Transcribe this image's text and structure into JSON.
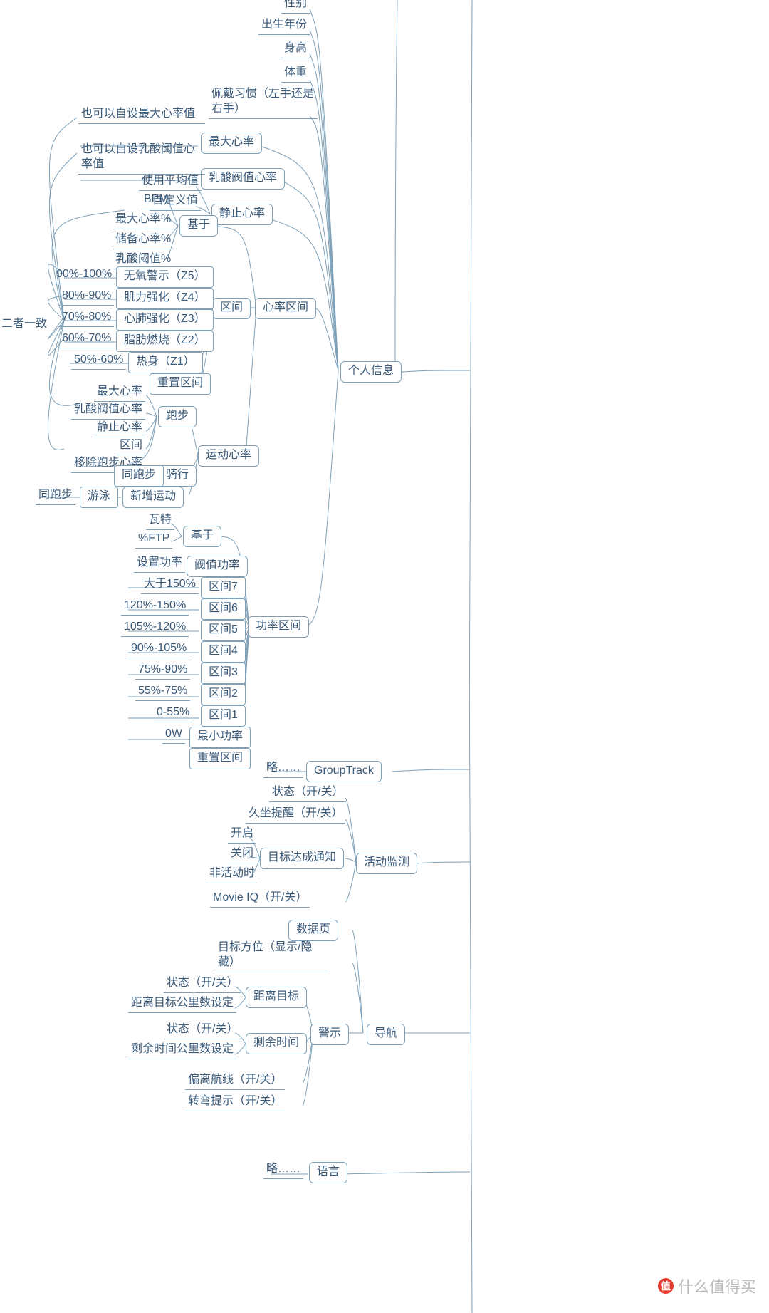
{
  "root_side_label": "二者一致",
  "personal_info": {
    "label": "个人信息",
    "gender": "性别",
    "birth_year": "出生年份",
    "height": "身高",
    "weight": "体重",
    "wear_habit": "佩戴习惯（左手还是右手）",
    "max_hr": {
      "label": "最大心率",
      "note": "也可以自设最大心率值"
    },
    "lactate_hr": {
      "label": "乳酸阀值心率",
      "note": "也可以自设乳酸阈值心率值"
    },
    "resting_hr": {
      "label": "静止心率",
      "avg": "使用平均值",
      "custom": "自定义值"
    },
    "hr_zone": {
      "label": "心率区间",
      "based_on": {
        "label": "基于",
        "opts": [
          "BPM",
          "最大心率%",
          "储备心率%",
          "乳酸阈值%"
        ]
      },
      "zones": {
        "label": "区间",
        "z5": {
          "name": "无氧警示（Z5）",
          "pct": "90%-100%"
        },
        "z4": {
          "name": "肌力强化（Z4）",
          "pct": "80%-90%"
        },
        "z3": {
          "name": "心肺强化（Z3）",
          "pct": "70%-80%"
        },
        "z2": {
          "name": "脂肪燃烧（Z2）",
          "pct": "60%-70%"
        },
        "z1": {
          "name": "热身（Z1）",
          "pct": "50%-60%"
        },
        "reset": "重置区间"
      },
      "sport_hr": {
        "label": "运动心率",
        "run": {
          "label": "跑步",
          "items": [
            "最大心率",
            "乳酸阀值心率",
            "静止心率",
            "区间"
          ],
          "remove": "移除跑步心率"
        },
        "ride": {
          "label": "骑行",
          "same": "同跑步"
        },
        "add": {
          "label": "新增运动",
          "swim": "游泳",
          "same": "同跑步"
        }
      }
    },
    "power_zone": {
      "label": "功率区间",
      "based_on": {
        "label": "基于",
        "opts": [
          "瓦特",
          "%FTP"
        ]
      },
      "threshold": {
        "label": "阀值功率",
        "note": "设置功率"
      },
      "z7": {
        "label": "区间7",
        "pct": "大于150%"
      },
      "z6": {
        "label": "区间6",
        "pct": "120%-150%"
      },
      "z5": {
        "label": "区间5",
        "pct": "105%-120%"
      },
      "z4": {
        "label": "区间4",
        "pct": "90%-105%"
      },
      "z3": {
        "label": "区间3",
        "pct": "75%-90%"
      },
      "z2": {
        "label": "区间2",
        "pct": "55%-75%"
      },
      "z1": {
        "label": "区间1",
        "pct": "0-55%"
      },
      "min": {
        "label": "最小功率",
        "pct": "0W"
      },
      "reset": "重置区间"
    }
  },
  "group_track": {
    "label": "GroupTrack",
    "omit": "略……"
  },
  "activity_monitor": {
    "label": "活动监测",
    "status": "状态（开/关）",
    "sit_remind": "久坐提醒（开/关）",
    "goal_notify": {
      "label": "目标达成通知",
      "opts": [
        "开启",
        "关闭",
        "非活动时"
      ]
    },
    "movie_iq": "Movie IQ（开/关）"
  },
  "navigation": {
    "label": "导航",
    "data_page": "数据页",
    "bearing": "目标方位（显示/隐藏）",
    "alert": {
      "label": "警示",
      "dist_goal": {
        "label": "距离目标",
        "status": "状态（开/关）",
        "set": "距离目标公里数设定"
      },
      "time_rem": {
        "label": "剩余时间",
        "status": "状态（开/关）",
        "set": "剩余时间公里数设定"
      },
      "off_course": "偏离航线（开/关）",
      "turn_prompt": "转弯提示（开/关）"
    }
  },
  "language": {
    "label": "语言",
    "omit": "略……"
  },
  "watermark": {
    "brand": "什么值得买",
    "badge": "值"
  }
}
